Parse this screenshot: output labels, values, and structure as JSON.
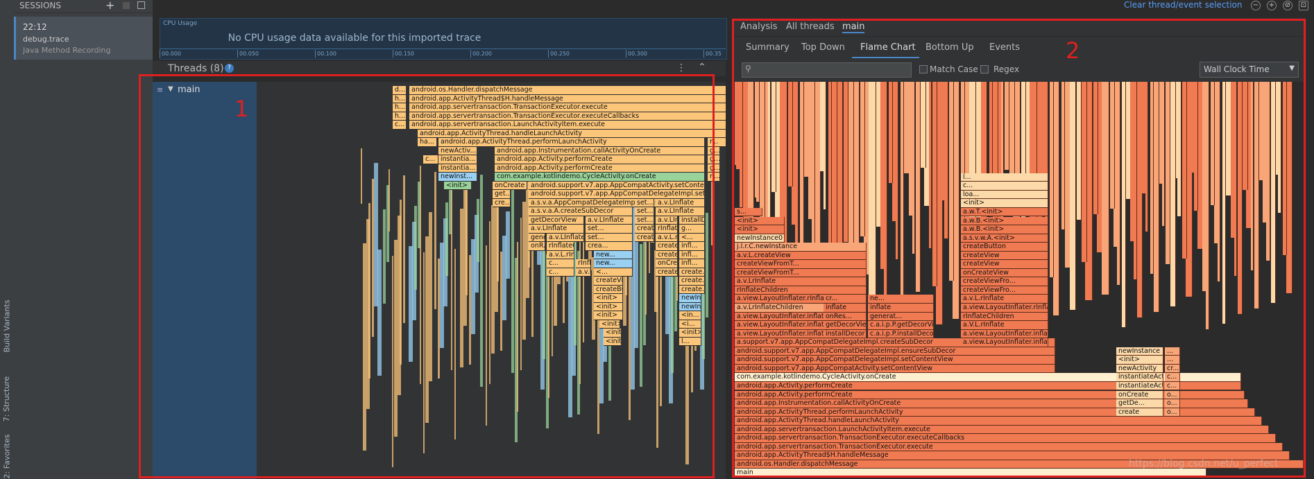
{
  "top": {
    "clear_selection": "Clear thread/event selection"
  },
  "sidebar_vertical": {
    "build_variants": "Build Variants",
    "structure": "7: Structure",
    "favorites": "2: Favorites"
  },
  "sessions": {
    "title": "SESSIONS",
    "add": "+",
    "item": {
      "time": "22:12",
      "file": "debug.trace",
      "type": "Java Method Recording"
    }
  },
  "cpu": {
    "label": "CPU Usage",
    "message": "No CPU usage data available for this imported trace",
    "ticks": [
      "00.000",
      "00.050",
      "00.100",
      "00.150",
      "00.200",
      "00.250",
      "00.300",
      "00.35"
    ]
  },
  "threads": {
    "title": "Threads (8)",
    "thread_name": "main"
  },
  "left_flames": [
    {
      "c": "fo",
      "t": "d..."
    },
    {
      "c": "fo",
      "t": "android.os.Handler.dispatchMessage"
    },
    {
      "c": "fo",
      "t": "h..."
    },
    {
      "c": "fo",
      "t": "android.app.ActivityThread$H.handleMessage"
    },
    {
      "c": "fo",
      "t": "h..."
    },
    {
      "c": "fo",
      "t": "android.app.servertransaction.TransactionExecutor.execute"
    },
    {
      "c": "fo",
      "t": "h..."
    },
    {
      "c": "fo",
      "t": "android.app.servertransaction.TransactionExecutor.executeCallbacks"
    },
    {
      "c": "fo",
      "t": "e..."
    },
    {
      "c": "fo",
      "t": "c..."
    },
    {
      "c": "fo",
      "t": "android.app.servertransaction.LaunchActivityItem.execute"
    },
    {
      "c": "fo",
      "t": "android.app.ActivityThread.handleLaunchActivity"
    },
    {
      "c": "fo",
      "t": "ha..."
    },
    {
      "c": "fo",
      "t": "android.app.ActivityThread.performLaunchActivity"
    },
    {
      "c": "fo",
      "t": "r..."
    },
    {
      "c": "fo",
      "t": "newActiv..."
    },
    {
      "c": "fo",
      "t": "android.app.Instrumentation.callActivityOnCreate"
    },
    {
      "c": "fo",
      "t": "g..."
    },
    {
      "c": "fo",
      "t": "c..."
    },
    {
      "c": "fo",
      "t": "instantia..."
    },
    {
      "c": "fo",
      "t": "android.app.Activity.performCreate"
    },
    {
      "c": "fo",
      "t": "g..."
    },
    {
      "c": "fo",
      "t": "instantia..."
    },
    {
      "c": "fo",
      "t": "android.app.Activity.performCreate"
    },
    {
      "c": "fo",
      "t": "g..."
    },
    {
      "c": "fb",
      "t": "newInst..."
    },
    {
      "c": "fg",
      "t": "com.example.kotlindemo.CycleActivity.onCreate"
    },
    {
      "c": "fo",
      "t": "n..."
    },
    {
      "c": "fg",
      "t": "<init>"
    },
    {
      "c": "fo",
      "t": "onCreate"
    },
    {
      "c": "fo",
      "t": "android.support.v7.app.AppCompatActivity.setContentView"
    },
    {
      "c": "fo",
      "t": "get..."
    },
    {
      "c": "fo",
      "t": "android.support.v7.app.AppCompatDelegateImpl.setContentView"
    },
    {
      "c": "fo",
      "t": "cre..."
    },
    {
      "c": "fo",
      "t": "a.s.v.a.AppCompatDelegateImpl.ensureSubDecor"
    },
    {
      "c": "fo",
      "t": "set..."
    },
    {
      "c": "fo",
      "t": "a.v.LInflate"
    },
    {
      "c": "fo",
      "t": "a.s.v.a.A.createSubDecor"
    },
    {
      "c": "fo",
      "t": "set..."
    },
    {
      "c": "fo",
      "t": "a.v.LInflate"
    },
    {
      "c": "fo",
      "t": "getDecorView"
    },
    {
      "c": "fo",
      "t": "a.v.LInflate"
    },
    {
      "c": "fo",
      "t": "set..."
    },
    {
      "c": "fo",
      "t": "a.v.LInflate"
    },
    {
      "c": "fo",
      "t": "installDecor"
    },
    {
      "c": "fo",
      "t": "a.v.LInflate"
    },
    {
      "c": "fo",
      "t": "set..."
    },
    {
      "c": "fo",
      "t": "creat..."
    },
    {
      "c": "fo",
      "t": "rInflateChil..."
    },
    {
      "c": "fo",
      "t": "g..."
    },
    {
      "c": "fo",
      "t": "gene..."
    },
    {
      "c": "fo",
      "t": "a.v.LInflate"
    },
    {
      "c": "fo",
      "t": "set..."
    },
    {
      "c": "fo",
      "t": "creat..."
    },
    {
      "c": "fo",
      "t": "a.v.L.rInflate"
    },
    {
      "c": "fo",
      "t": "<..."
    },
    {
      "c": "fo",
      "t": "onR..."
    },
    {
      "c": "fo",
      "t": "rInflateChildren"
    },
    {
      "c": "fo",
      "t": "crea..."
    },
    {
      "c": "fo",
      "t": "createVie..."
    },
    {
      "c": "fo",
      "t": "infl..."
    },
    {
      "c": "fo",
      "t": "a.v.L.rInflate"
    },
    {
      "c": "fb",
      "t": "new..."
    },
    {
      "c": "fo",
      "t": "createVie..."
    },
    {
      "c": "fo",
      "t": "infl..."
    },
    {
      "c": "fo",
      "t": "c..."
    },
    {
      "c": "fo",
      "t": "rInflateChild..."
    },
    {
      "c": "fb",
      "t": "new..."
    },
    {
      "c": "fo",
      "t": "onCreate..."
    },
    {
      "c": "fo",
      "t": "infl..."
    },
    {
      "c": "fo",
      "t": "c..."
    },
    {
      "c": "fo",
      "t": "a.v.L.rInflate"
    },
    {
      "c": "fo",
      "t": "<..."
    },
    {
      "c": "fo",
      "t": "createView"
    },
    {
      "c": "fo",
      "t": "create..."
    },
    {
      "c": "fo",
      "t": "createView"
    },
    {
      "c": "fo",
      "t": "create..."
    },
    {
      "c": "fo",
      "t": "createBut..."
    },
    {
      "c": "fo",
      "t": "create..."
    },
    {
      "c": "fo",
      "t": "<init>"
    },
    {
      "c": "fb",
      "t": "newIn..."
    },
    {
      "c": "fo",
      "t": "<init>"
    },
    {
      "c": "fb",
      "t": "newIn..."
    },
    {
      "c": "fo",
      "t": "<init>"
    },
    {
      "c": "fo",
      "t": "<in..."
    },
    {
      "c": "fo",
      "t": "<init>"
    },
    {
      "c": "fo",
      "t": "<i..."
    },
    {
      "c": "fo",
      "t": "<init>"
    },
    {
      "c": "fo",
      "t": "<init>"
    },
    {
      "c": "fo",
      "t": "<init>"
    },
    {
      "c": "fo",
      "t": "l..."
    }
  ],
  "analysis": {
    "tabs_top": [
      "Analysis",
      "All threads",
      "main"
    ],
    "tabs": [
      "Summary",
      "Top Down",
      "Flame Chart",
      "Bottom Up",
      "Events"
    ],
    "active_tab": "Flame Chart",
    "search_placeholder": "",
    "match_case": "Match Case",
    "regex": "Regex",
    "clock": "Wall Clock Time"
  },
  "right_flames": [
    "main",
    "android.os.Handler.dispatchMessage",
    "android.app.ActivityThread$H.handleMessage",
    "android.app.servertransaction.TransactionExecutor.execute",
    "android.app.servertransaction.TransactionExecutor.executeCallbacks",
    "android.app.servertransaction.LaunchActivityItem.execute",
    "android.app.ActivityThread.handleLaunchActivity",
    "android.app.ActivityThread.performLaunchActivity",
    "android.app.Instrumentation.callActivityOnCreate",
    "android.app.Activity.performCreate",
    "android.app.Activity.performCreate",
    "com.example.kotlindemo.CycleActivity.onCreate",
    "android.support.v7.app.AppCompatActivity.setContentView",
    "android.support.v7.app.AppCompatDelegateImpl.setContentView",
    "android.support.v7.app.AppCompatDelegateImpl.ensureSubDecor",
    "a.support.v7.app.AppCompatDelegateImpl.createSubDecor",
    "a.view.LayoutInflater.inflate",
    "a.view.LayoutInflater.inflate",
    "a.view.LayoutInflater.inflate",
    "a.v.LrInflateChildren",
    "a.view.LayoutInflater.rInflate",
    "rInflateChildren",
    "a.v.LrInflate",
    "createViewFromT...",
    "createViewFromT...",
    "a.v.L.createView",
    "j.l.r.C.newInstance",
    "newInstance0",
    "<init>",
    "<init>",
    "s..."
  ],
  "right_extra": [
    [
      "installDecor",
      "c.a.i.p.P.installDecor"
    ],
    [
      "getDecorView",
      "c.a.i.p.P.getDecorView"
    ],
    [
      "onRes...",
      "generat..."
    ],
    [
      "inflate",
      "inflate"
    ],
    [
      "cr...",
      "ne..."
    ]
  ],
  "right_mid": [
    "a.view.LayoutInflater.inflate",
    "a.view.LayoutInflater.inflate",
    "a.V.L.rInflate",
    "rInflateChildren",
    "a.view.LayoutInflater.rInflate",
    "a.v.L.rInflate",
    "createViewFro...",
    "createViewFro...",
    "onCreateView",
    "createView",
    "createView",
    "createButton",
    "a.s.v.w.A.<init>",
    "a.w.B.<init>",
    "a.w.B.<init>",
    "a.w.T.<init>",
    "<init>",
    "loa...",
    "c...",
    "l..."
  ],
  "right_col3": [
    [
      "create",
      "o..."
    ],
    [
      "getDe...",
      "o..."
    ],
    [
      "onCreate",
      "o..."
    ],
    [
      "instantiateAct...",
      "c..."
    ],
    [
      "instantiateAct...",
      "c..."
    ],
    [
      "newActivity",
      "cr..."
    ],
    [
      "<init>",
      "..."
    ],
    [
      "newInstance",
      "..."
    ]
  ],
  "watermark": "https://blog.csdn.net/u_perfect",
  "annotations": {
    "one": "1",
    "two": "2"
  }
}
